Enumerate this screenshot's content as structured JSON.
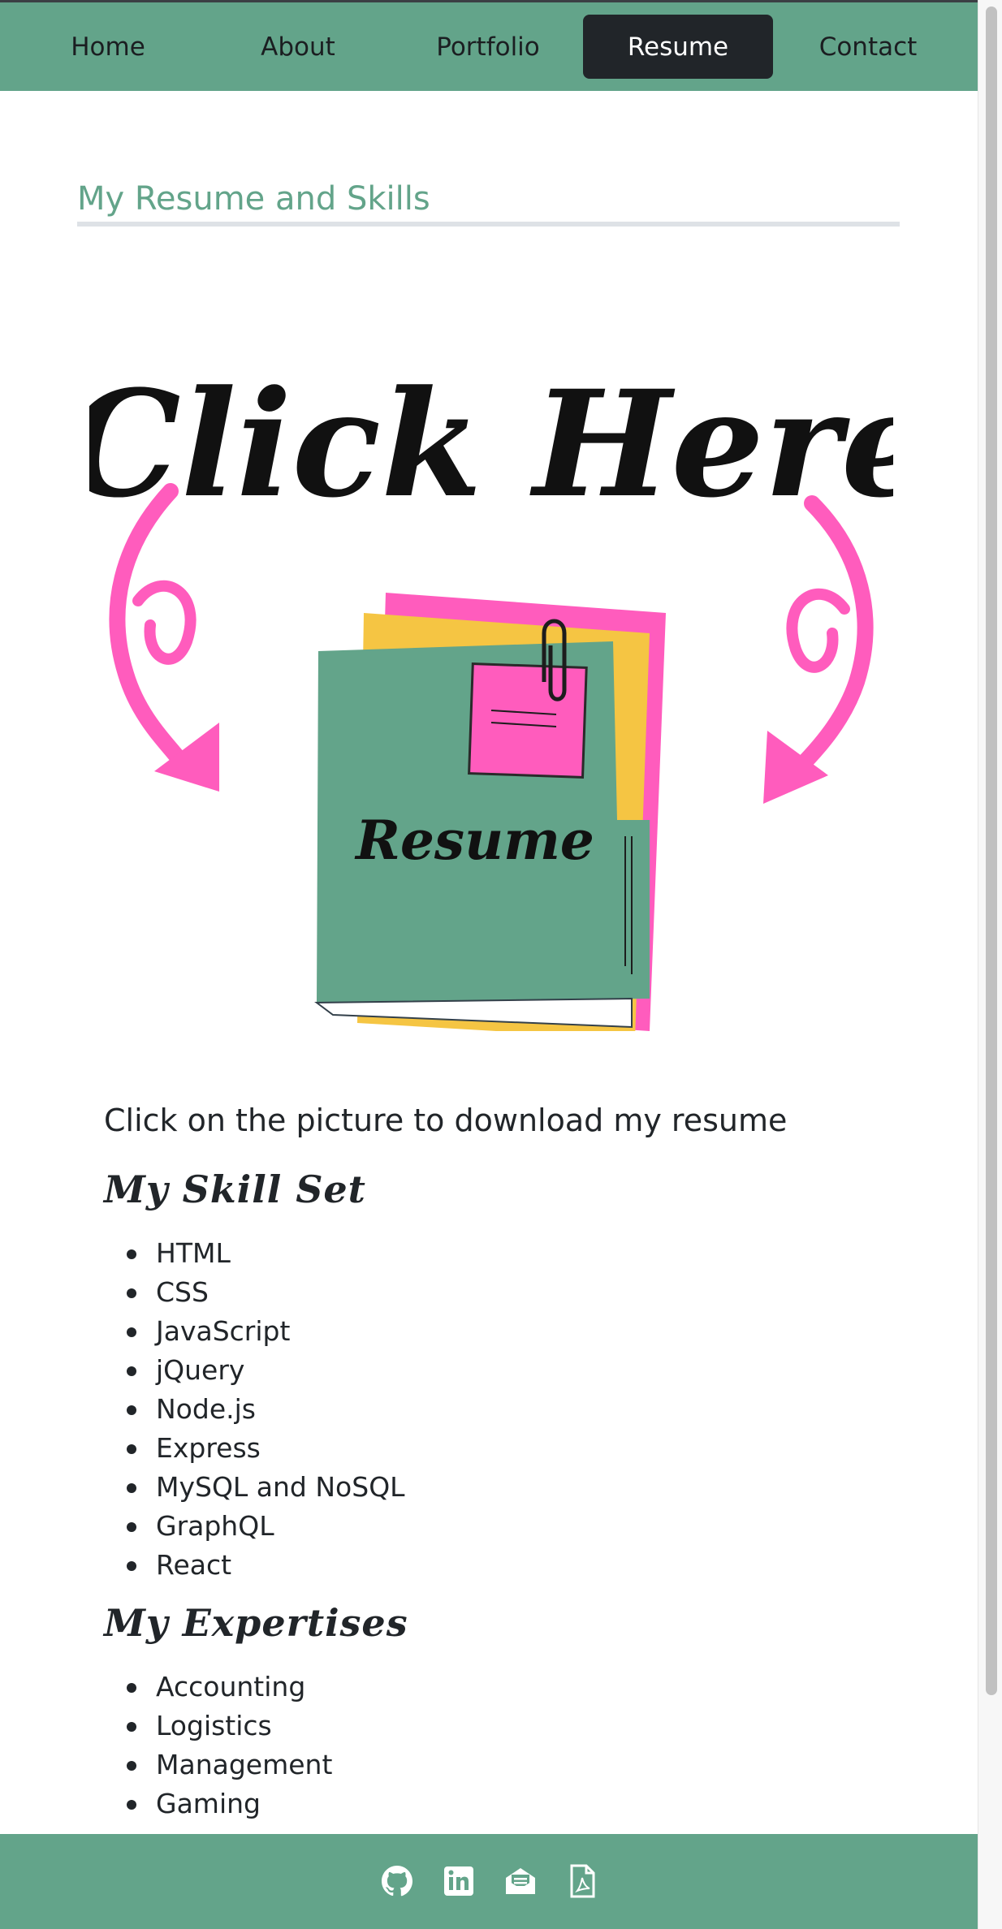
{
  "nav": {
    "items": [
      {
        "label": "Home",
        "active": false
      },
      {
        "label": "About",
        "active": false
      },
      {
        "label": "Portfolio",
        "active": false
      },
      {
        "label": "Resume",
        "active": true
      },
      {
        "label": "Contact",
        "active": false
      }
    ]
  },
  "main": {
    "section_title": "My Resume and Skills",
    "image_text": {
      "headline": "Click Here",
      "folder_label": "Resume"
    },
    "download_text": "Click on the picture to download my resume",
    "skills_heading": "My Skill Set",
    "skills": [
      "HTML",
      "CSS",
      "JavaScript",
      "jQuery",
      "Node.js",
      "Express",
      "MySQL and NoSQL",
      "GraphQL",
      "React"
    ],
    "expertise_heading": "My Expertises",
    "expertises": [
      "Accounting",
      "Logistics",
      "Management",
      "Gaming"
    ]
  },
  "footer": {
    "icons": [
      "github-icon",
      "linkedin-icon",
      "email-icon",
      "pdf-icon"
    ]
  },
  "colors": {
    "accent": "#63a48a",
    "active_nav": "#212529",
    "pink": "#ff5cbd",
    "yellow": "#f5c543"
  }
}
